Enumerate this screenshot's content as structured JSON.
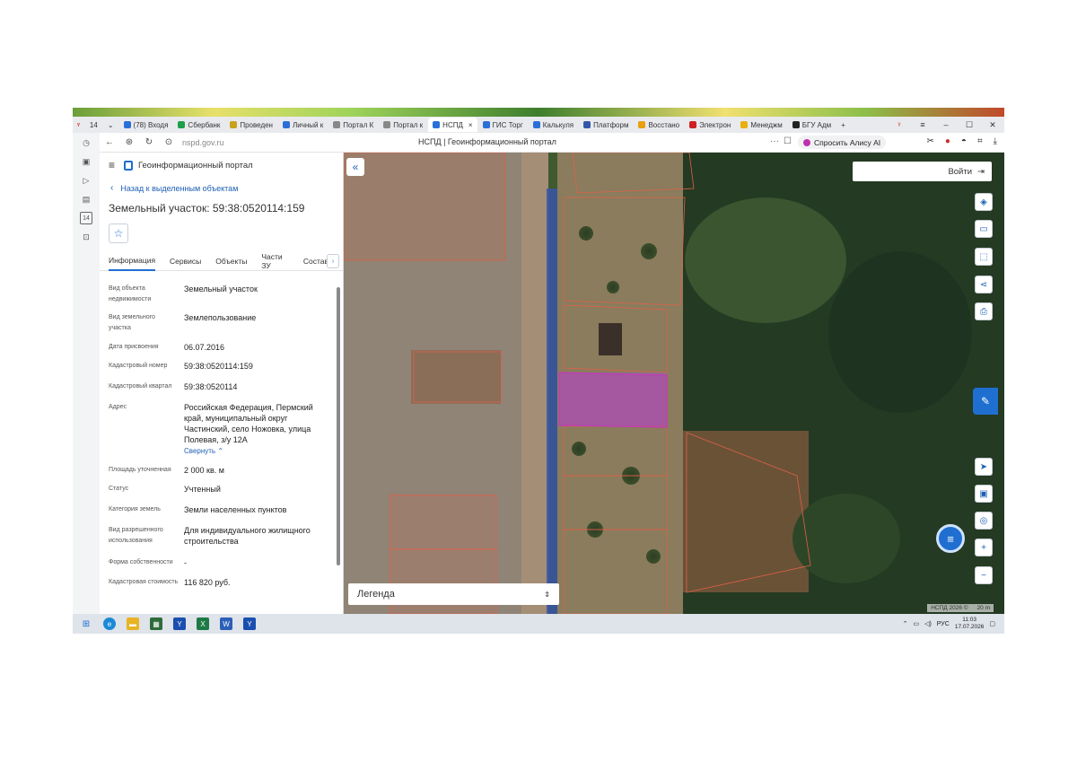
{
  "browser": {
    "tab_count": "14",
    "tabs": [
      {
        "label": "(78) Входя",
        "color": "#2a6fd8"
      },
      {
        "label": "Сбербанк",
        "color": "#1ea04a"
      },
      {
        "label": "Проведен",
        "color": "#c8a21a"
      },
      {
        "label": "Личный к",
        "color": "#2a6fd8"
      },
      {
        "label": "Портал К",
        "color": "#888888"
      },
      {
        "label": "Портал к",
        "color": "#888888"
      },
      {
        "label": "НСПД",
        "color": "#2a6fd8",
        "active": true,
        "close": "×"
      },
      {
        "label": "ГИС Торг",
        "color": "#2a6fd8"
      },
      {
        "label": "Калькуля",
        "color": "#2a6fd8"
      },
      {
        "label": "Платформ",
        "color": "#3355aa"
      },
      {
        "label": "Восстано",
        "color": "#e8a010"
      },
      {
        "label": "Электрон",
        "color": "#d02020"
      },
      {
        "label": "Менеджм",
        "color": "#e8b010"
      },
      {
        "label": "БГУ Адм",
        "color": "#222222"
      }
    ],
    "new_tab": "+",
    "url": "nspd.gov.ru",
    "page_title": "НСПД | Геоинформационный портал",
    "alisa_label": "Спросить Алису AI",
    "more": "···"
  },
  "rail": {
    "badge": "14"
  },
  "panel": {
    "portal_title": "Геоинформационный портал",
    "back_label": "Назад к выделенным объектам",
    "object_title": "Земельный участок: 59:38:0520114:159",
    "tabs": [
      "Информация",
      "Сервисы",
      "Объекты",
      "Части ЗУ",
      "Состав"
    ],
    "more_tab": "›",
    "rows": [
      {
        "label": "Вид объекта недвижимости",
        "value": "Земельный участок"
      },
      {
        "label": "Вид земельного участка",
        "value": "Землепользование"
      },
      {
        "label": "Дата присвоения",
        "value": "06.07.2016"
      },
      {
        "label": "Кадастровый номер",
        "value": "59:38:0520114:159"
      },
      {
        "label": "Кадастровый квартал",
        "value": "59:38:0520114"
      },
      {
        "label": "Адрес",
        "value": "Российская Федерация, Пермский край, муниципальный округ Частинский, село Ножовка, улица Полевая, з/у 12А",
        "collapse": "Свернуть"
      },
      {
        "label": "Площадь уточненная",
        "value": "2 000 кв. м"
      },
      {
        "label": "Статус",
        "value": "Учтенный"
      },
      {
        "label": "Категория земель",
        "value": "Земли населенных пунктов"
      },
      {
        "label": "Вид разрешенного использования",
        "value": "Для индивидуального жилищного строительства"
      },
      {
        "label": "Форма собственности",
        "value": "-"
      },
      {
        "label": "Кадастровая стоимость",
        "value": "116 820 руб."
      }
    ]
  },
  "map": {
    "login_label": "Войти",
    "legend_label": "Легенда",
    "copyright": "НСПД 2026 ©",
    "scale": "20 m"
  },
  "taskbar": {
    "lang": "РУС",
    "time": "11:03",
    "date": "17.07.2026"
  }
}
